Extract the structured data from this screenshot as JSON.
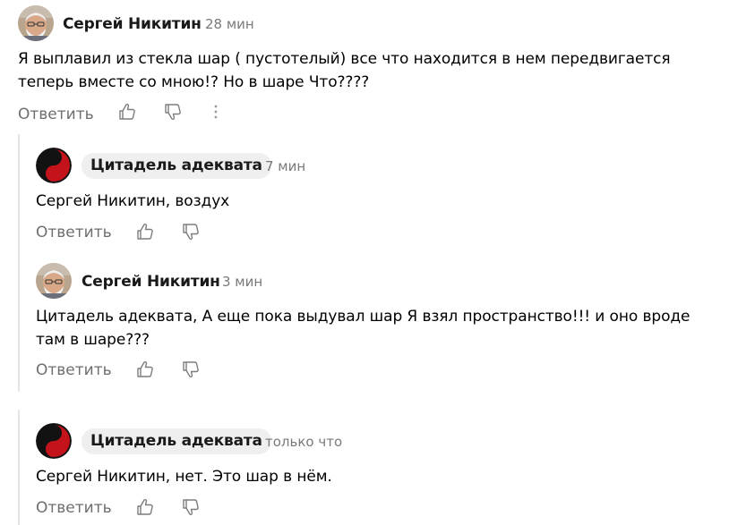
{
  "comments": [
    {
      "author": "Сергей Никитин",
      "time": "28 мин",
      "text": "Я выплавил из стекла шар ( пустотелый) все что находится в нем передвигается теперь вместе со мною!? Но в шаре Что????",
      "reply_label": "Ответить",
      "avatar": "bearded-man-avatar"
    },
    {
      "author": "Цитадель адеквата",
      "time": "7 мин",
      "text": "Сергей Никитин, воздух",
      "reply_label": "Ответить",
      "avatar": "yin-yang-avatar"
    },
    {
      "author": "Сергей Никитин",
      "time": "3 мин",
      "text": "Цитадель адеквата, А еще пока выдувал шар Я взял пространство!!! и оно вроде там в шаре???",
      "reply_label": "Ответить",
      "avatar": "bearded-man-avatar"
    },
    {
      "author": "Цитадель адеквата",
      "time": "только что",
      "text": "Сергей Никитин, нет. Это шар в нём.",
      "reply_label": "Ответить",
      "avatar": "yin-yang-avatar"
    }
  ],
  "icons": {
    "like": "thumbs-up-icon",
    "dislike": "thumbs-down-icon",
    "more": "more-vertical-icon"
  },
  "colors": {
    "text": "#000000",
    "meta": "#7a7a7a",
    "chip_bg": "#efefef",
    "thread_line": "#e4e4e4"
  }
}
